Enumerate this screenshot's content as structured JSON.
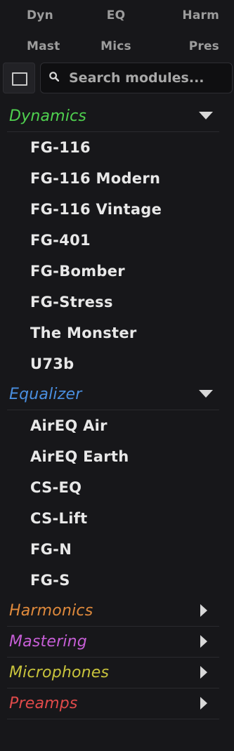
{
  "filters": {
    "row1": [
      "Dyn",
      "EQ",
      "Harm"
    ],
    "row2": [
      "Mast",
      "Mics",
      "Pres"
    ]
  },
  "search": {
    "placeholder": "Search modules...",
    "value": ""
  },
  "categories": [
    {
      "label": "Dynamics",
      "color": "#4fd14f",
      "expanded": true,
      "icon": "caret-down-icon",
      "items": [
        "FG-116",
        "FG-116 Modern",
        "FG-116 Vintage",
        "FG-401",
        "FG-Bomber",
        "FG-Stress",
        "The Monster",
        "U73b"
      ]
    },
    {
      "label": "Equalizer",
      "color": "#4a8fe0",
      "expanded": true,
      "icon": "caret-down-icon",
      "items": [
        "AirEQ Air",
        "AirEQ Earth",
        "CS-EQ",
        "CS-Lift",
        "FG-N",
        "FG-S"
      ]
    },
    {
      "label": "Harmonics",
      "color": "#e08a3c",
      "expanded": false,
      "icon": "caret-right-icon",
      "items": []
    },
    {
      "label": "Mastering",
      "color": "#c65ed6",
      "expanded": false,
      "icon": "caret-right-icon",
      "items": []
    },
    {
      "label": "Microphones",
      "color": "#c9c43c",
      "expanded": false,
      "icon": "caret-right-icon",
      "items": []
    },
    {
      "label": "Preamps",
      "color": "#e04a4a",
      "expanded": false,
      "icon": "caret-right-icon",
      "items": []
    }
  ]
}
